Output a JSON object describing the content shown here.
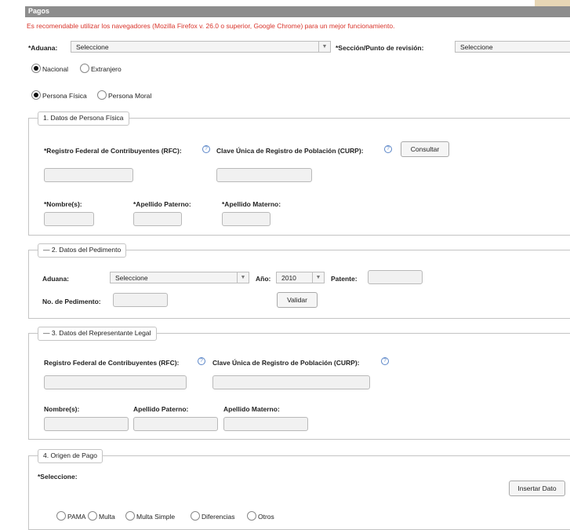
{
  "header": {
    "title": "Pagos"
  },
  "warning": "Es recomendable utilizar los navegadores (Mozilla Firefox v. 26.0 o superior, Google Chrome) para un mejor funcionamiento.",
  "top": {
    "aduana_label": "*Aduana:",
    "aduana_value": "Seleccione",
    "seccion_label": "*Sección/Punto de revisión:",
    "seccion_value": "Seleccione",
    "nacional": "Nacional",
    "extranjero": "Extranjero",
    "persona_fisica": "Persona Física",
    "persona_moral": "Persona Moral"
  },
  "section1": {
    "legend": "1. Datos de Persona Física",
    "rfc_label": "*Registro Federal de Contribuyentes (RFC):",
    "curp_label": "Clave Única de Registro de Población (CURP):",
    "consultar": "Consultar",
    "nombre_label": "*Nombre(s):",
    "paterno_label": "*Apellido Paterno:",
    "materno_label": "*Apellido Materno:"
  },
  "section2": {
    "legend": "— 2. Datos del Pedimento",
    "aduana_label": "Aduana:",
    "aduana_value": "Seleccione",
    "anio_label": "Año:",
    "anio_value": "2010",
    "patente_label": "Patente:",
    "pedimento_label": "No. de Pedimento:",
    "validar": "Validar"
  },
  "section3": {
    "legend": "— 3. Datos del Representante Legal",
    "rfc_label": "Registro Federal de Contribuyentes (RFC):",
    "curp_label": "Clave Única de Registro de Población (CURP):",
    "nombre_label": "Nombre(s):",
    "paterno_label": "Apellido Paterno:",
    "materno_label": "Apellido Materno:"
  },
  "section4": {
    "legend": "4. Origen de Pago",
    "seleccione_label": "*Seleccione:",
    "insertar": "Insertar Dato",
    "options": [
      "PAMA",
      "Multa",
      "Multa Simple",
      "Diferencias",
      "Otros"
    ]
  },
  "icons": {
    "help": "help-icon",
    "dropdown": "chevron-down-icon"
  }
}
